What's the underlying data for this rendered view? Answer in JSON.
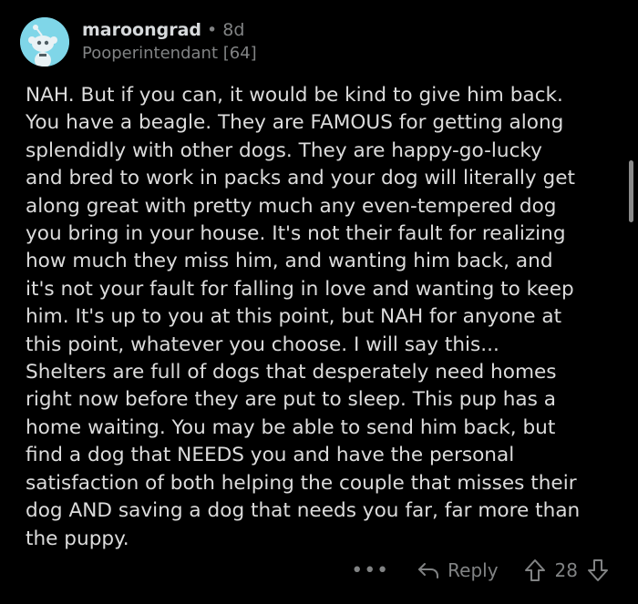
{
  "comment": {
    "username": "maroongrad",
    "separator": "•",
    "age": "8d",
    "flair": "Pooperintendant [64]",
    "body": "NAH. But if you can, it would be kind to give him back.\nYou have a beagle. They are FAMOUS for getting along\nsplendidly with other dogs. They are happy-go-lucky\nand bred to work in packs and your dog will literally get\nalong great with pretty much any even-tempered dog\nyou bring in your house. It's not their fault for realizing\nhow much they miss him, and wanting him back, and\nit's not your fault for falling in love and wanting to keep\nhim. It's up to you at this point, but NAH for anyone at\nthis point, whatever you choose. I will say this...\nShelters are full of dogs that desperately need homes\nright now before they are put to sleep. This pup has a\nhome waiting. You may be able to send him back, but\nfind a dog that NEEDS you and have the personal\nsatisfaction of both helping the couple that misses their\ndog AND saving a dog that needs you far, far more than\nthe puppy."
  },
  "actions": {
    "more_label": "•••",
    "reply_label": "Reply",
    "score": "28",
    "icons": {
      "more": "more-options-icon",
      "reply": "reply-arrow-icon",
      "upvote": "upvote-arrow-icon",
      "downvote": "downvote-arrow-icon"
    }
  },
  "colors": {
    "background": "#000000",
    "text": "#dcdcdc",
    "muted": "#818384",
    "avatar_bg": "#7fd6e8"
  }
}
